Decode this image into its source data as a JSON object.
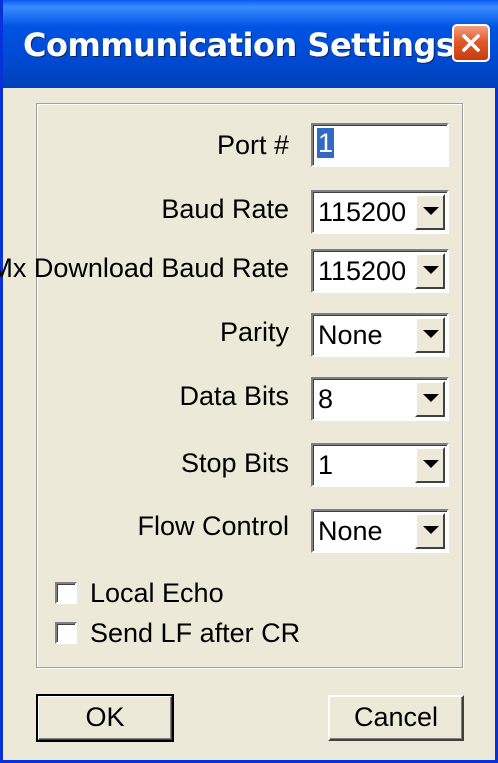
{
  "window": {
    "title": "Communication Settings"
  },
  "fields": {
    "port": {
      "label": "Port #",
      "value": "1"
    },
    "baud_rate": {
      "label": "Baud Rate",
      "value": "115200"
    },
    "mx_download_baud_rate": {
      "label": "Mx Download Baud Rate",
      "value": "115200"
    },
    "parity": {
      "label": "Parity",
      "value": "None"
    },
    "data_bits": {
      "label": "Data Bits",
      "value": "8"
    },
    "stop_bits": {
      "label": "Stop Bits",
      "value": "1"
    },
    "flow_control": {
      "label": "Flow Control",
      "value": "None"
    }
  },
  "checkboxes": {
    "local_echo": {
      "label": "Local Echo",
      "checked": false
    },
    "send_lf_after_cr": {
      "label": "Send LF after CR",
      "checked": false
    }
  },
  "buttons": {
    "ok": "OK",
    "cancel": "Cancel"
  },
  "icons": {
    "close": "close-icon",
    "dropdown": "chevron-down-icon"
  },
  "colors": {
    "titlebar": "#0054e3",
    "close_button": "#e25a2c",
    "dialog_bg": "#ece9d8"
  }
}
